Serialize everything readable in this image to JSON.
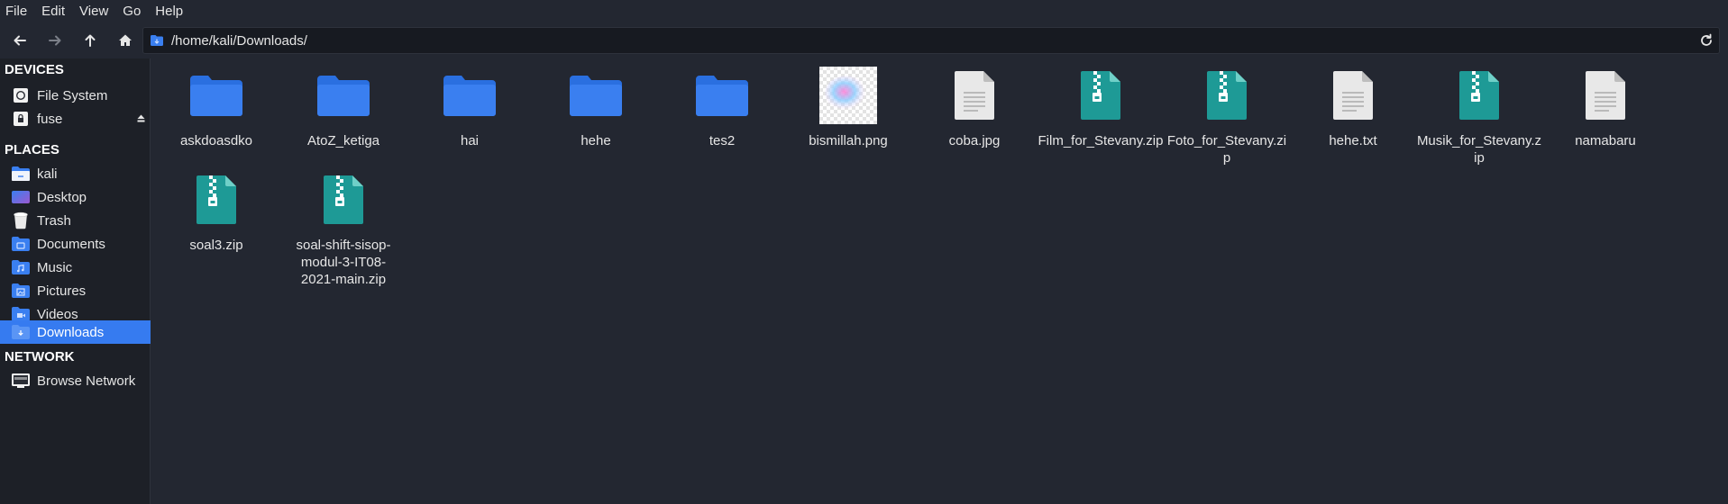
{
  "menubar": {
    "items": [
      "File",
      "Edit",
      "View",
      "Go",
      "Help"
    ]
  },
  "toolbar": {
    "back_icon": "arrow-left-icon",
    "forward_icon": "arrow-right-icon",
    "up_icon": "arrow-up-icon",
    "home_icon": "home-icon",
    "reload_icon": "reload-icon"
  },
  "location": {
    "path": "/home/kali/Downloads/"
  },
  "sidebar": {
    "devices_header": "DEVICES",
    "places_header": "PLACES",
    "network_header": "NETWORK",
    "devices": [
      {
        "label": "File System",
        "icon": "harddisk-icon"
      },
      {
        "label": "fuse",
        "icon": "drive-icon"
      }
    ],
    "places": [
      {
        "label": "kali",
        "icon": "home-folder-icon"
      },
      {
        "label": "Desktop",
        "icon": "desktop-icon"
      },
      {
        "label": "Trash",
        "icon": "trash-icon"
      },
      {
        "label": "Documents",
        "icon": "documents-folder-icon"
      },
      {
        "label": "Music",
        "icon": "music-folder-icon"
      },
      {
        "label": "Pictures",
        "icon": "pictures-folder-icon"
      },
      {
        "label": "Videos",
        "icon": "videos-folder-icon"
      },
      {
        "label": "Downloads",
        "icon": "downloads-folder-icon",
        "active": true
      }
    ],
    "network": [
      {
        "label": "Browse Network",
        "icon": "network-icon"
      }
    ]
  },
  "files": [
    {
      "name": "askdoasdko",
      "type": "folder"
    },
    {
      "name": "AtoZ_ketiga",
      "type": "folder"
    },
    {
      "name": "hai",
      "type": "folder"
    },
    {
      "name": "hehe",
      "type": "folder"
    },
    {
      "name": "tes2",
      "type": "folder"
    },
    {
      "name": "bismillah.png",
      "type": "image"
    },
    {
      "name": "coba.jpg",
      "type": "text"
    },
    {
      "name": "Film_for_Stevany.zip",
      "type": "zip"
    },
    {
      "name": "Foto_for_Stevany.zip",
      "type": "zip"
    },
    {
      "name": "hehe.txt",
      "type": "text"
    },
    {
      "name": "Musik_for_Stevany.zip",
      "type": "zip"
    },
    {
      "name": "namabaru",
      "type": "text"
    },
    {
      "name": "soal3.zip",
      "type": "zip"
    },
    {
      "name": "soal-shift-sisop-modul-3-IT08-2021-main.zip",
      "type": "zip"
    }
  ],
  "colors": {
    "accent": "#367bf0",
    "folder": "#3a7ff0",
    "zip": "#1e9a96",
    "background": "#232731",
    "sidebar": "#1d2027"
  }
}
